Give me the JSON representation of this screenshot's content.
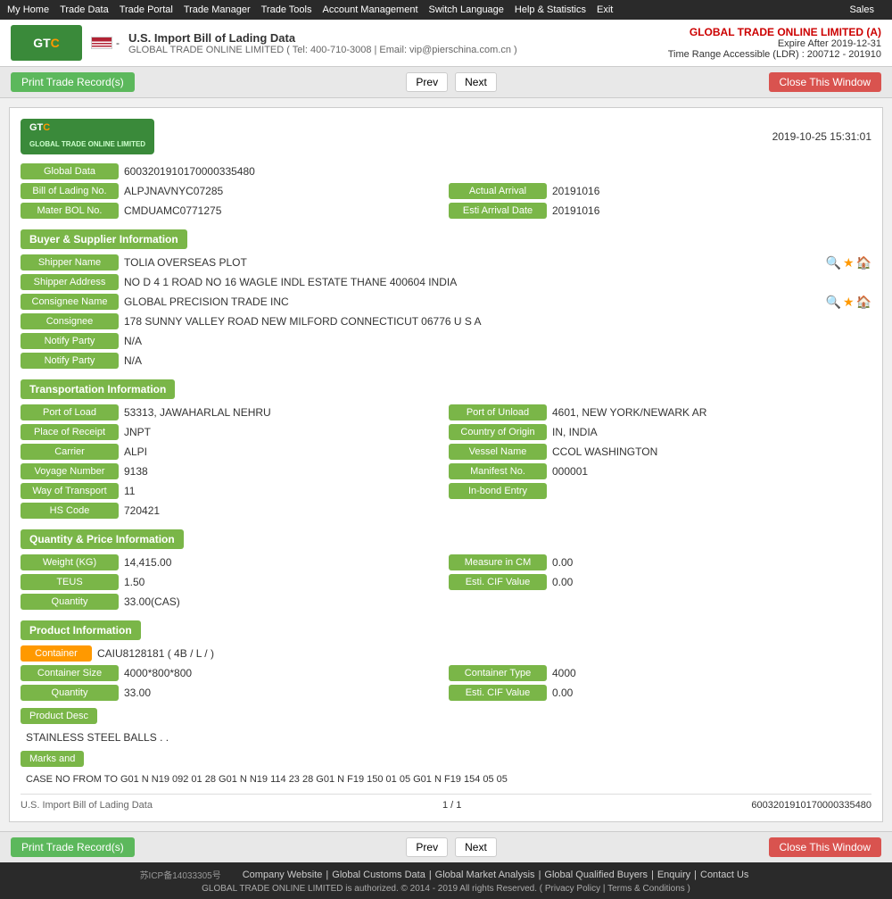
{
  "topnav": {
    "items": [
      "My Home",
      "Trade Data",
      "Trade Portal",
      "Trade Manager",
      "Trade Tools",
      "Account Management",
      "Switch Language",
      "Help & Statistics",
      "Exit",
      "Sales"
    ]
  },
  "header": {
    "logo_text": "GTC",
    "flag_alt": "US Flag",
    "title": "U.S. Import Bill of Lading Data",
    "subtitle": "GLOBAL TRADE ONLINE LIMITED ( Tel: 400-710-3008 | Email: vip@pierschina.com.cn )",
    "company": "GLOBAL TRADE ONLINE LIMITED (A)",
    "expire": "Expire After 2019-12-31",
    "time_range": "Time Range Accessible (LDR) : 200712 - 201910"
  },
  "toolbar": {
    "print_label": "Print Trade Record(s)",
    "prev_label": "Prev",
    "next_label": "Next",
    "close_label": "Close This Window"
  },
  "record": {
    "timestamp": "2019-10-25 15:31:01",
    "global_data_label": "Global Data",
    "global_data_value": "6003201910170000335480",
    "bol_label": "Bill of Lading No.",
    "bol_value": "ALPJNAVNYC07285",
    "actual_arrival_label": "Actual Arrival",
    "actual_arrival_value": "20191016",
    "master_bol_label": "Mater BOL No.",
    "master_bol_value": "CMDUAMC0771275",
    "esti_arrival_label": "Esti Arrival Date",
    "esti_arrival_value": "20191016",
    "buyer_supplier_section": "Buyer & Supplier Information",
    "shipper_name_label": "Shipper Name",
    "shipper_name_value": "TOLIA OVERSEAS PLOT",
    "shipper_address_label": "Shipper Address",
    "shipper_address_value": "NO D 4 1 ROAD NO 16 WAGLE INDL ESTATE THANE 400604 INDIA",
    "consignee_name_label": "Consignee Name",
    "consignee_name_value": "GLOBAL PRECISION TRADE INC",
    "consignee_label": "Consignee",
    "consignee_value": "178 SUNNY VALLEY ROAD NEW MILFORD CONNECTICUT 06776 U S A",
    "notify_party1_label": "Notify Party",
    "notify_party1_value": "N/A",
    "notify_party2_label": "Notify Party",
    "notify_party2_value": "N/A",
    "transport_section": "Transportation Information",
    "port_load_label": "Port of Load",
    "port_load_value": "53313, JAWAHARLAL NEHRU",
    "port_unload_label": "Port of Unload",
    "port_unload_value": "4601, NEW YORK/NEWARK AR",
    "place_receipt_label": "Place of Receipt",
    "place_receipt_value": "JNPT",
    "country_origin_label": "Country of Origin",
    "country_origin_value": "IN, INDIA",
    "carrier_label": "Carrier",
    "carrier_value": "ALPI",
    "vessel_name_label": "Vessel Name",
    "vessel_name_value": "CCOL WASHINGTON",
    "voyage_number_label": "Voyage Number",
    "voyage_number_value": "9138",
    "manifest_no_label": "Manifest No.",
    "manifest_no_value": "000001",
    "way_transport_label": "Way of Transport",
    "way_transport_value": "11",
    "in_bond_entry_label": "In-bond Entry",
    "in_bond_entry_value": "",
    "hs_code_label": "HS Code",
    "hs_code_value": "720421",
    "quantity_price_section": "Quantity & Price Information",
    "weight_label": "Weight (KG)",
    "weight_value": "14,415.00",
    "measure_cm_label": "Measure in CM",
    "measure_cm_value": "0.00",
    "teus_label": "TEUS",
    "teus_value": "1.50",
    "esti_cif_label": "Esti. CIF Value",
    "esti_cif_value": "0.00",
    "quantity_label": "Quantity",
    "quantity_value": "33.00(CAS)",
    "product_section": "Product Information",
    "container_label": "Container",
    "container_value": "CAIU8128181 ( 4B / L / )",
    "container_size_label": "Container Size",
    "container_size_value": "4000*800*800",
    "container_type_label": "Container Type",
    "container_type_value": "4000",
    "product_quantity_label": "Quantity",
    "product_quantity_value": "33.00",
    "product_esti_cif_label": "Esti. CIF Value",
    "product_esti_cif_value": "0.00",
    "product_desc_label": "Product Desc",
    "product_desc_value": "STAINLESS STEEL BALLS . .",
    "marks_label": "Marks and",
    "marks_value": "CASE NO FROM TO G01 N N19 092 01 28 G01 N N19 114 23 28 G01 N F19 150 01 05 G01 N F19 154 05 05",
    "footer_title": "U.S. Import Bill of Lading Data",
    "footer_page": "1 / 1",
    "footer_id": "6003201910170000335480"
  },
  "footer": {
    "icp": "苏ICP备14033305号",
    "links": [
      "Company Website",
      "Global Customs Data",
      "Global Market Analysis",
      "Global Qualified Buyers",
      "Enquiry",
      "Contact Us"
    ],
    "copyright": "GLOBAL TRADE ONLINE LIMITED is authorized. © 2014 - 2019 All rights Reserved. ( Privacy Policy | Terms & Conditions )"
  }
}
